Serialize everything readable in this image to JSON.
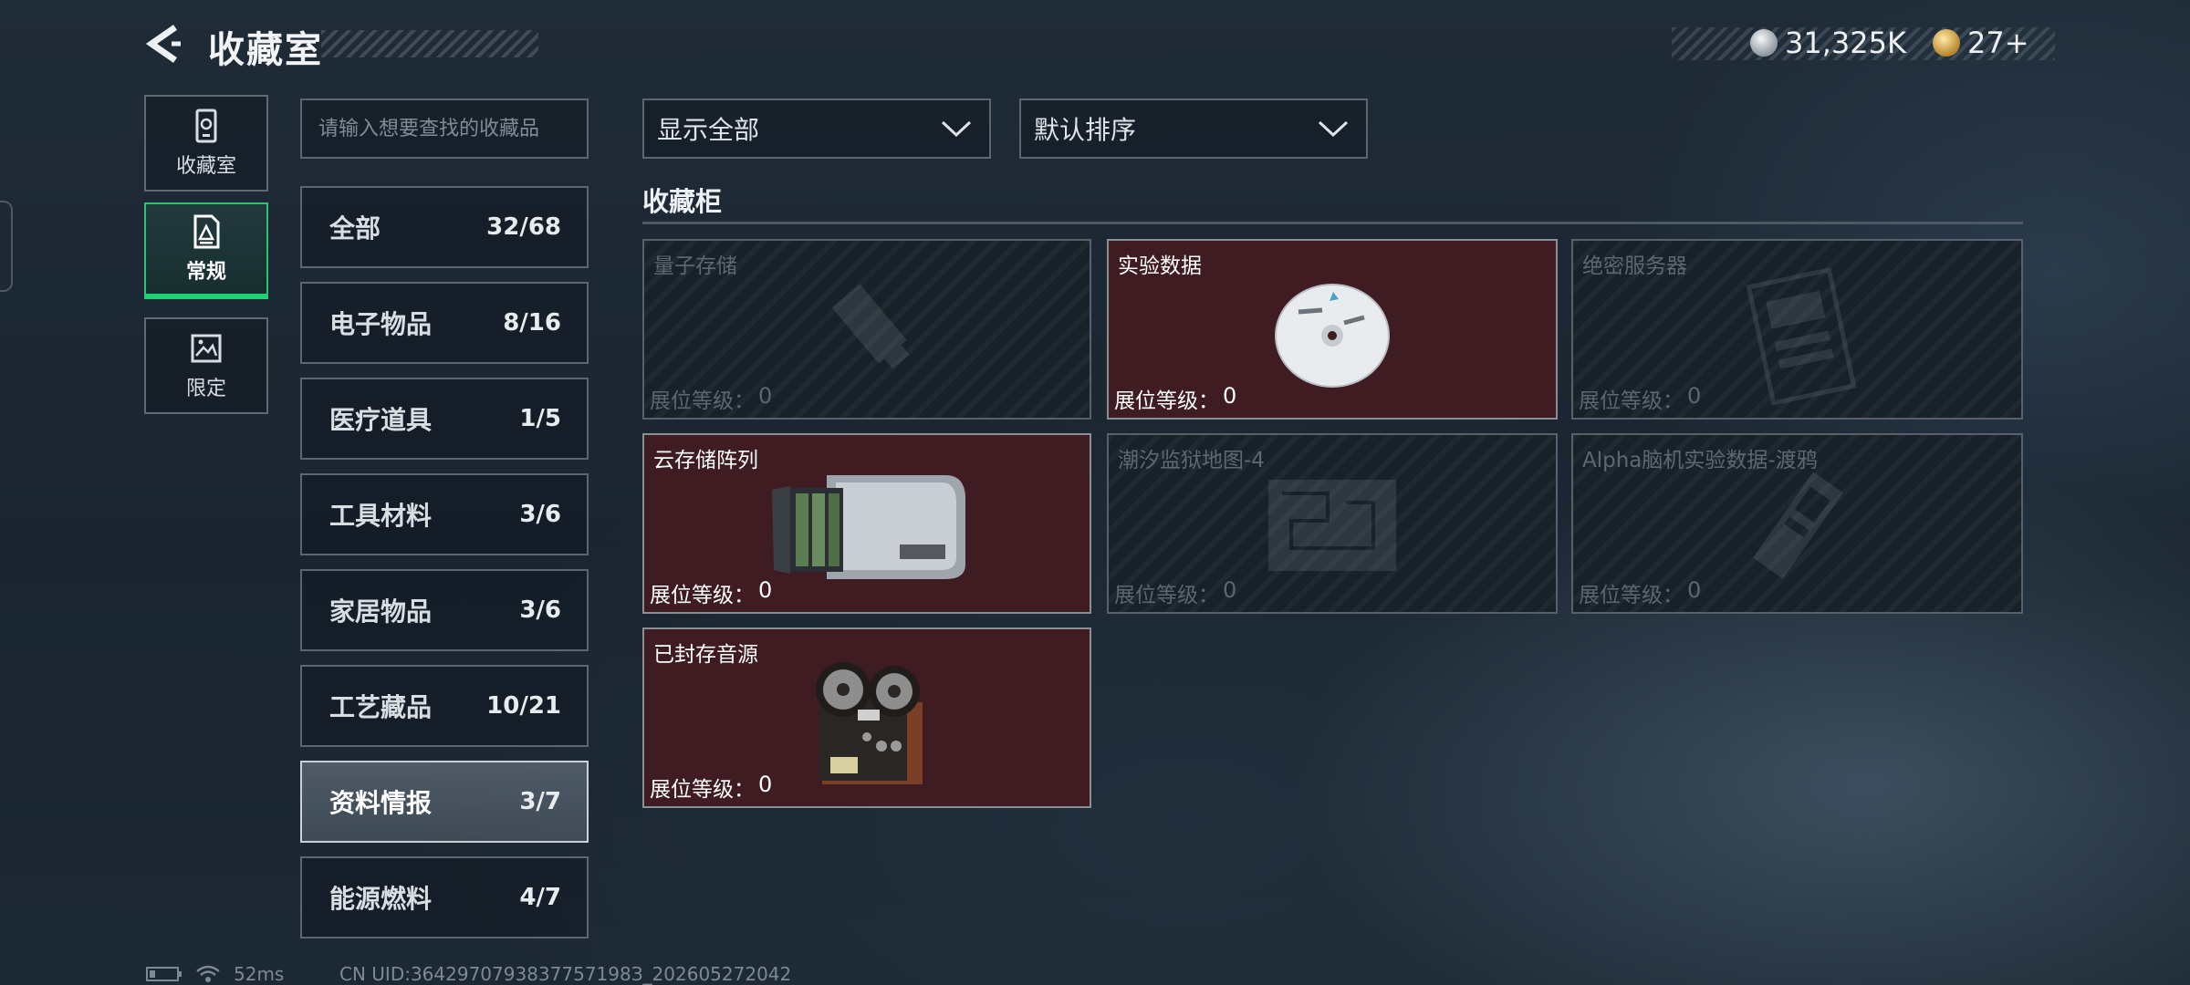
{
  "header": {
    "title": "收藏室",
    "currencies": [
      {
        "icon": "silver-coin-icon",
        "value": "31,325K"
      },
      {
        "icon": "gold-coin-icon",
        "value": "27+"
      }
    ]
  },
  "rail": [
    {
      "label": "收藏室",
      "icon": "archive-icon",
      "active": false
    },
    {
      "label": "常规",
      "icon": "document-icon",
      "active": true
    },
    {
      "label": "限定",
      "icon": "picture-icon",
      "active": false
    }
  ],
  "search": {
    "placeholder": "请输入想要查找的收藏品",
    "value": ""
  },
  "categories": [
    {
      "name": "全部",
      "count": "32/68"
    },
    {
      "name": "电子物品",
      "count": "8/16"
    },
    {
      "name": "医疗道具",
      "count": "1/5"
    },
    {
      "name": "工具材料",
      "count": "3/6"
    },
    {
      "name": "家居物品",
      "count": "3/6"
    },
    {
      "name": "工艺藏品",
      "count": "10/21"
    },
    {
      "name": "资料情报",
      "count": "3/7",
      "active": true
    },
    {
      "name": "能源燃料",
      "count": "4/7"
    }
  ],
  "filters": {
    "show": "显示全部",
    "sort": "默认排序"
  },
  "section": {
    "title": "收藏柜"
  },
  "cards": [
    {
      "name": "量子存储",
      "level_label": "展位等级：",
      "level": "0",
      "owned": false,
      "art": "usb-drive-icon"
    },
    {
      "name": "实验数据",
      "level_label": "展位等级：",
      "level": "0",
      "owned": true,
      "art": "disc-icon"
    },
    {
      "name": "绝密服务器",
      "level_label": "展位等级：",
      "level": "0",
      "owned": false,
      "art": "server-board-icon"
    },
    {
      "name": "云存储阵列",
      "level_label": "展位等级：",
      "level": "0",
      "owned": true,
      "art": "storage-array-icon"
    },
    {
      "name": "潮汐监狱地图-4",
      "level_label": "展位等级：",
      "level": "0",
      "owned": false,
      "art": "map-icon"
    },
    {
      "name": "Alpha脑机实验数据-渡鸦",
      "level_label": "展位等级：",
      "level": "0",
      "owned": false,
      "art": "data-cartridge-icon"
    },
    {
      "name": "已封存音源",
      "level_label": "展位等级：",
      "level": "0",
      "owned": true,
      "art": "reel-to-reel-icon"
    }
  ],
  "footer": {
    "ping": "52ms",
    "uid": "CN UID:3642970793837757198З_202605272042"
  },
  "colors": {
    "owned_card": "#3f1c22",
    "active_tab": "#22d07a",
    "background": "#1f2b37"
  }
}
